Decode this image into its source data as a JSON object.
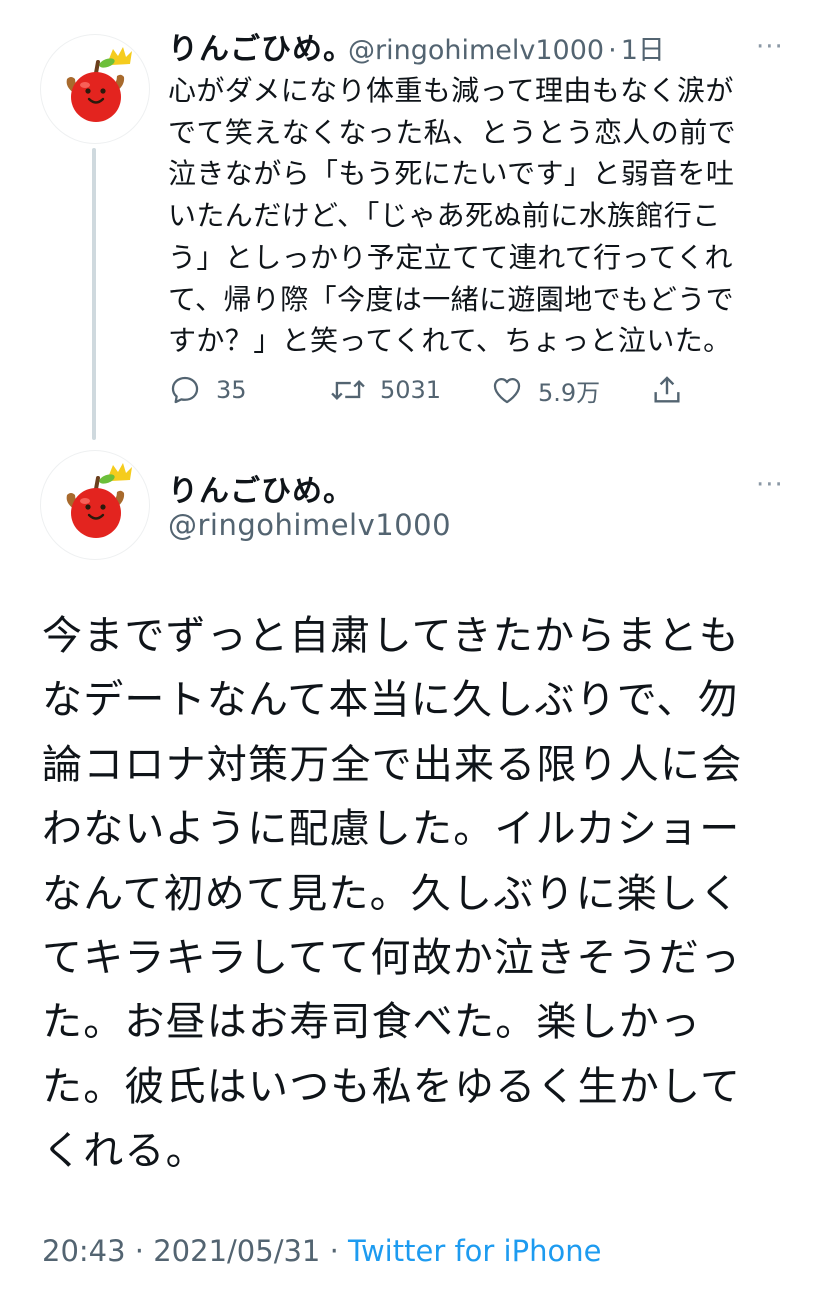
{
  "tweet1": {
    "name": "りんごひめ。",
    "handle": "@ringohimelv1000",
    "time": "1日",
    "meta_sep": "·",
    "more": "···",
    "text": "心がダメになり体重も減って理由もなく涙が\nでて笑えなくなった私、とうとう恋人の前で\n泣きながら「もう死にたいです」と弱音を吐\nいたんだけど、「じゃあ死ぬ前に水族館行こ\nう」としっかり予定立てて連れて行ってくれ\nて、帰り際「今度は一緒に遊園地でもどうで\nすか？」と笑ってくれて、ちょっと泣いた。",
    "replies": "35",
    "retweets": "5031",
    "likes": "5.9万"
  },
  "tweet2": {
    "name": "りんごひめ。",
    "handle": "@ringohimelv1000",
    "more": "···",
    "text": "今までずっと自粛してきたからまとも\nなデートなんて本当に久しぶりで、勿\n論コロナ対策万全で出来る限り人に会\nわないように配慮した。イルカショー\nなんて初めて見た。久しぶりに楽しく\nてキラキラしてて何故か泣きそうだっ\nた。お昼はお寿司食べた。楽しかっ\nた。彼氏はいつも私をゆるく生かして\nくれる。",
    "time": "20:43",
    "date": "2021/05/31",
    "sep": "·",
    "source": "Twitter for iPhone"
  },
  "icons": {
    "avatar": "red-apple-mascot-with-crown",
    "reply": "speech-bubble-icon",
    "retweet": "retweet-arrows-icon",
    "like": "heart-icon",
    "share": "share-upload-icon",
    "more": "three-dots-icon"
  },
  "colors": {
    "text": "#0f1419",
    "secondary": "#536471",
    "link": "#1d9bf0",
    "thread_line": "#cfd9de"
  }
}
